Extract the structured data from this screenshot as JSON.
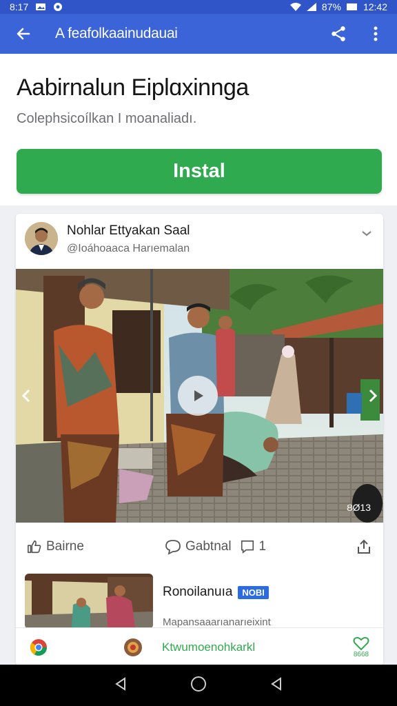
{
  "status": {
    "time_left": "8:17",
    "battery": "87%",
    "time_right": "12:42"
  },
  "appbar": {
    "title": "A feafolkaainudauai"
  },
  "header": {
    "title": "Aabirnalun Eiplɑxinnga",
    "subtitle": "Colephsicoílkan I moanaliadı.",
    "install_label": "Instal"
  },
  "post": {
    "author": "Nohlar Ettyakan Saal",
    "handle": "@Ioáhoaaca Harıemalan",
    "watermark": "ȢØ13",
    "actions": {
      "like": "Bairne",
      "comment": "Gabtnal",
      "comment_count": "1"
    }
  },
  "related": {
    "title": "Ronoilanuıa",
    "badge": "NOBI",
    "subtitle": "Mapansaaarıanarıeixint"
  },
  "bottombar": {
    "link": "Ktwumoenohkarkl",
    "heart_label": "8668"
  },
  "colors": {
    "appbar": "#3a64d8",
    "install": "#2faa4e",
    "badge": "#2d6be0"
  }
}
